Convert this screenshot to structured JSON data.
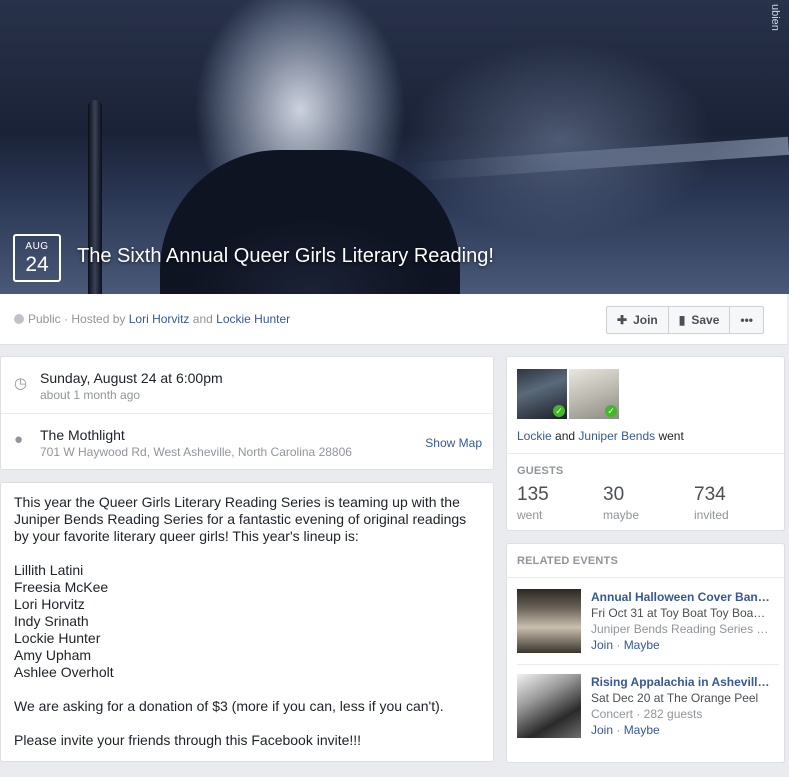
{
  "cover": {
    "watermark": "ubien",
    "month": "AUG",
    "day": "24",
    "title": "The Sixth Annual Queer Girls Literary Reading!"
  },
  "info_bar": {
    "privacy": "Public",
    "hosted_by_prefix": "· Hosted by",
    "host1": "Lori Horvitz",
    "and": "and",
    "host2": "Lockie Hunter",
    "join_label": "Join",
    "save_label": "Save",
    "more_label": "•••"
  },
  "when": {
    "date": "Sunday, August 24 at 6:00pm",
    "relative": "about 1 month ago"
  },
  "where": {
    "venue": "The Mothlight",
    "address": "701 W Haywood Rd, West Asheville, North Carolina 28806",
    "map_label": "Show Map"
  },
  "description": {
    "intro": "This year the Queer Girls Literary Reading Series is teaming up with the Juniper Bends Reading Series for a fantastic evening of original readings by your favorite literary queer girls! This year's lineup is:",
    "lineup": [
      "Lillith Latini",
      "Freesia McKee",
      "Lori Horvitz",
      "Indy Srinath",
      "Lockie Hunter",
      "Amy Upham",
      "Ashlee Overholt"
    ],
    "donation": "We are asking for a donation of $3 (more if you can, less if you can't).",
    "invite": "Please invite your friends through this Facebook invite!!!"
  },
  "friends_went": {
    "name1": "Lockie",
    "and": "and",
    "name2": "Juniper Bends",
    "suffix": "went"
  },
  "guests": {
    "heading": "GUESTS",
    "went_count": "135",
    "went_label": "went",
    "maybe_count": "30",
    "maybe_label": "maybe",
    "invited_count": "734",
    "invited_label": "invited"
  },
  "related": {
    "heading": "RELATED EVENTS",
    "events": [
      {
        "title": "Annual Halloween Cover Ban…",
        "date": "Fri Oct 31 at Toy Boat Toy Boa…",
        "host": "Juniper Bends Reading Series …",
        "join": "Join",
        "maybe": "Maybe"
      },
      {
        "title": "Rising Appalachia in Ashevill…",
        "date": "Sat Dec 20 at The Orange Peel",
        "host": "Concert · 282 guests",
        "join": "Join",
        "maybe": "Maybe"
      }
    ]
  }
}
